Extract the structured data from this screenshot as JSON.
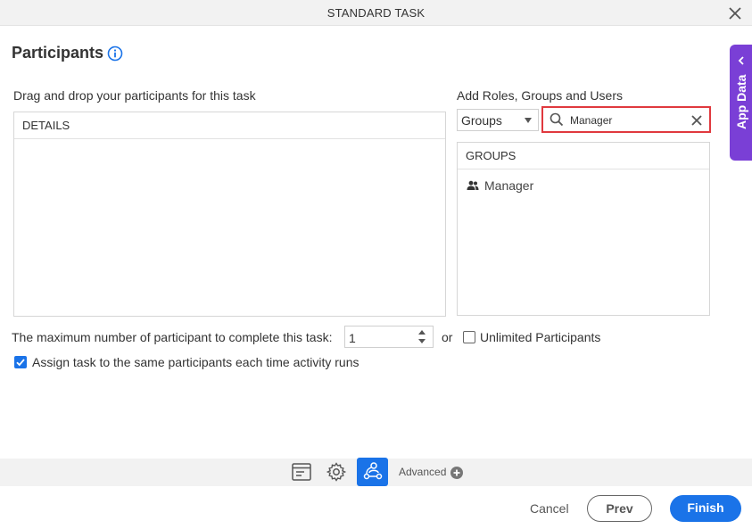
{
  "window": {
    "title": "STANDARD TASK"
  },
  "page": {
    "heading": "Participants"
  },
  "side_tab": {
    "label": "App Data"
  },
  "left": {
    "label": "Drag and drop your participants for this task",
    "panel_header": "DETAILS"
  },
  "right": {
    "label": "Add Roles, Groups and Users",
    "type_select": "Groups",
    "search_value": "Manager",
    "panel_header": "GROUPS",
    "items": [
      "Manager"
    ]
  },
  "options": {
    "max_label": "The maximum number of participant to complete this task:",
    "max_value": "1",
    "or_text": "or",
    "unlimited_label": "Unlimited Participants",
    "unlimited_checked": false,
    "assign_label": "Assign task to the same participants each time activity runs",
    "assign_checked": true
  },
  "toolbar": {
    "advanced_label": "Advanced"
  },
  "footer": {
    "cancel": "Cancel",
    "prev": "Prev",
    "finish": "Finish"
  },
  "colors": {
    "accent": "#1a73e8",
    "app_data": "#7a3fd6",
    "search_border": "#e0393e"
  }
}
